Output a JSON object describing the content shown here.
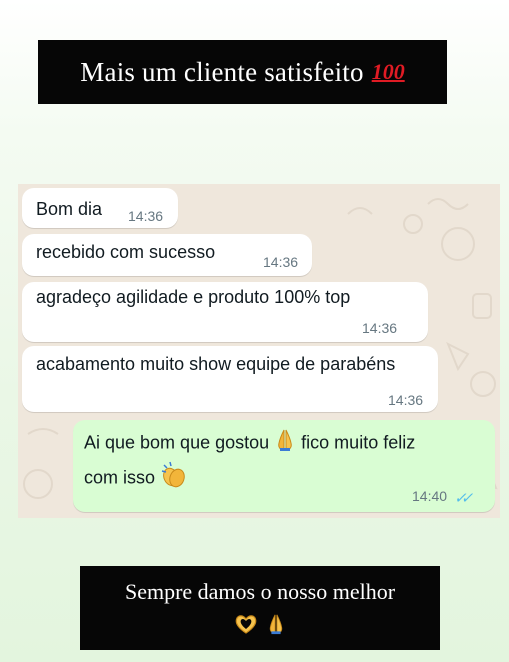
{
  "header": {
    "title": "Mais um cliente satisfeito",
    "title_emoji": "100",
    "title_emoji_icon": "hundred-points-icon",
    "title_emoji_color": "#e01b24"
  },
  "chat": {
    "background_color": "#efe7dc",
    "incoming_bubble_color": "#ffffff",
    "outgoing_bubble_color": "#d9fdd3",
    "received": [
      {
        "text": "Bom dia",
        "time": "14:36"
      },
      {
        "text": "recebido com sucesso",
        "time": "14:36"
      },
      {
        "text": "agradeço agilidade e produto 100% top",
        "time": "14:36"
      },
      {
        "text": "acabamento muito show equipe de parabéns",
        "time": "14:36"
      }
    ],
    "sent": {
      "part1": "Ai que bom que gostou",
      "emoji1": "folded-hands-icon",
      "part2": "fico muito feliz",
      "part3": "com isso",
      "emoji2": "clapping-hands-icon",
      "time": "14:40",
      "status": "read",
      "status_icon": "double-check-icon",
      "status_color": "#53bdeb"
    }
  },
  "footer": {
    "text": "Sempre damos o nosso melhor",
    "emojis": [
      "heart-hands-icon",
      "folded-hands-icon"
    ]
  }
}
